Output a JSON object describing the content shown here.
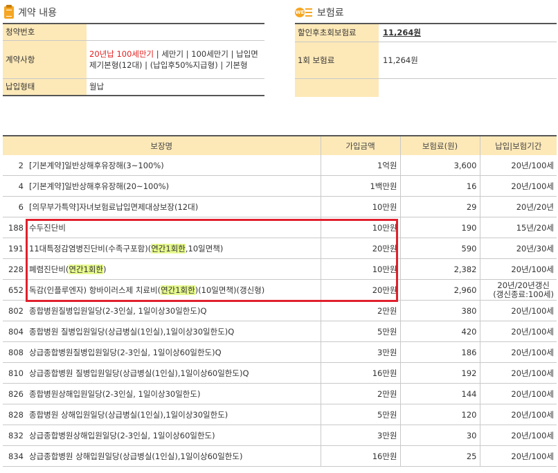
{
  "contract_section": {
    "title": "계약 내용",
    "rows": [
      {
        "label": "청약번호",
        "value": ""
      },
      {
        "label": "계약사항",
        "value_red": "20년납 100세만기",
        "value_rest": " | 세만기 | 100세만기 | 납입면제기본형(12대) | (납입후50%지급형) | 기본형"
      },
      {
        "label": "납입형태",
        "value": "월납"
      }
    ]
  },
  "premium_section": {
    "title": "보험료",
    "icon_text": "WE",
    "rows": [
      {
        "label": "할인후초회보험료",
        "value": "11,264원"
      },
      {
        "label": "1회 보험료",
        "value": "11,264원"
      },
      {
        "label": "",
        "value": ""
      }
    ]
  },
  "coverage_table": {
    "headers": [
      "보장명",
      "가입금액",
      "보험료(원)",
      "납입|보험기간"
    ],
    "rows": [
      {
        "no": "2",
        "name": "[기본계약]일반상해후유장해(3~100%)",
        "amount": "1억원",
        "premium": "3,600",
        "term": "20년/100세"
      },
      {
        "no": "4",
        "name": "[기본계약]일반상해후유장해(20~100%)",
        "amount": "1백만원",
        "premium": "16",
        "term": "20년/100세"
      },
      {
        "no": "6",
        "name": "[의무부가특약]자녀보험료납입면제대상보장(12대)",
        "amount": "10만원",
        "premium": "29",
        "term": "20년/20년"
      },
      {
        "no": "188",
        "name": "수두진단비",
        "amount": "10만원",
        "premium": "190",
        "term": "15년/20세"
      },
      {
        "no": "191",
        "name_a": "11대특정감염병진단비(수족구포함)(",
        "name_hl": "연간1회한",
        "name_b": ",10일면책)",
        "amount": "20만원",
        "premium": "590",
        "term": "20년/30세"
      },
      {
        "no": "228",
        "name_a": "폐렴진단비(",
        "name_hl": "연간1회한",
        "name_b": ")",
        "amount": "10만원",
        "premium": "2,382",
        "term": "20년/100세"
      },
      {
        "no": "652",
        "name_a": "독감(인플루엔자) 항바이러스제 치료비(",
        "name_hl": "연간1회한",
        "name_b": ")(10일면책)(갱신형)",
        "amount": "20만원",
        "premium": "2,960",
        "term_line1": "20년/20년갱신",
        "term_line2": "(갱신종료:100세)"
      },
      {
        "no": "802",
        "name": "종합병원질병입원일당(2-3인실, 1일이상30일한도)Q",
        "amount": "2만원",
        "premium": "380",
        "term": "20년/100세"
      },
      {
        "no": "804",
        "name": "종합병원 질병입원일당(상급병실(1인실),1일이상30일한도)Q",
        "amount": "5만원",
        "premium": "420",
        "term": "20년/100세"
      },
      {
        "no": "808",
        "name": "상급종합병원질병입원일당(2-3인실, 1일이상60일한도)Q",
        "amount": "3만원",
        "premium": "186",
        "term": "20년/100세"
      },
      {
        "no": "810",
        "name": "상급종합병원 질병입원일당(상급병실(1인실),1일이상60일한도)Q",
        "amount": "16만원",
        "premium": "192",
        "term": "20년/100세"
      },
      {
        "no": "826",
        "name": "종합병원상해입원일당(2-3인실, 1일이상30일한도)",
        "amount": "2만원",
        "premium": "144",
        "term": "20년/100세"
      },
      {
        "no": "828",
        "name": "종합병원 상해입원일당(상급병실(1인실),1일이상30일한도)",
        "amount": "5만원",
        "premium": "120",
        "term": "20년/100세"
      },
      {
        "no": "832",
        "name": "상급종합병원상해입원일당(2-3인실, 1일이상60일한도)",
        "amount": "3만원",
        "premium": "30",
        "term": "20년/100세"
      },
      {
        "no": "834",
        "name": "상급종합병원 상해입원일당(상급병실(1인실),1일이상60일한도)",
        "amount": "16만원",
        "premium": "25",
        "term": "20년/100세"
      }
    ]
  },
  "colors": {
    "header_bg": "#fde9b8",
    "highlight": "#e6f98e",
    "red_box": "#e0202e",
    "accent": "#f5a623"
  }
}
